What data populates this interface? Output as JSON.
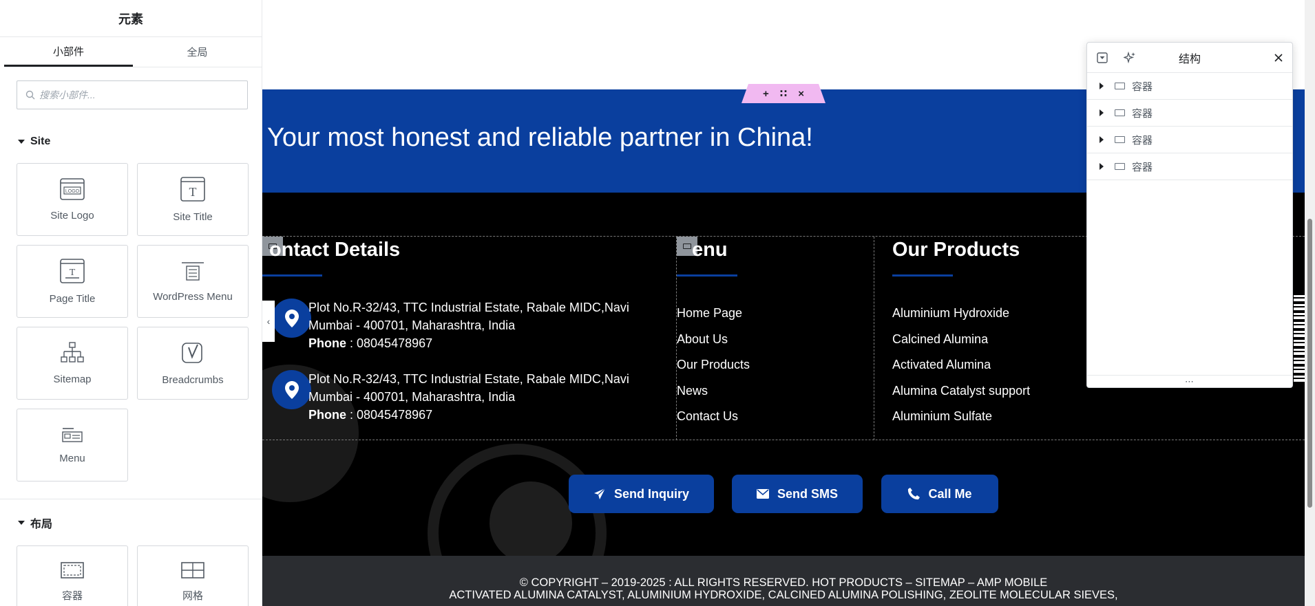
{
  "left_panel": {
    "title": "元素",
    "tabs": [
      "小部件",
      "全局"
    ],
    "search_placeholder": "搜索小部件...",
    "site_section": {
      "title": "Site",
      "widgets": [
        "Site Logo",
        "Site Title",
        "Page Title",
        "WordPress Menu",
        "Sitemap",
        "Breadcrumbs",
        "Menu"
      ]
    },
    "layout_section": {
      "title": "布局",
      "widgets": [
        "容器",
        "网格"
      ]
    }
  },
  "canvas": {
    "hero_text": "Your most honest and reliable partner in China!",
    "section_handle": {
      "add": "+",
      "move": "∷",
      "close": "×"
    },
    "footer": {
      "contact": {
        "heading": "ontact Details",
        "addresses": [
          {
            "line": "Plot No.R-32/43, TTC Industrial Estate, Rabale MIDC,Navi Mumbai - 400701, Maharashtra, India",
            "phone_label": "Phone",
            "phone": " : 08045478967"
          },
          {
            "line": "Plot No.R-32/43, TTC Industrial Estate, Rabale MIDC,Navi Mumbai - 400701, Maharashtra, India",
            "phone_label": "Phone",
            "phone": " : 08045478967"
          }
        ]
      },
      "menu": {
        "heading": "enu",
        "links": [
          "Home Page",
          "About Us",
          "Our Products",
          "News",
          "Contact Us"
        ]
      },
      "products": {
        "heading": "Our Products",
        "links": [
          "Aluminium Hydroxide",
          "Calcined Alumina",
          "Activated Alumina",
          "Alumina Catalyst support",
          "Aluminium Sulfate"
        ]
      },
      "cta_buttons": [
        "Send Inquiry",
        "Send SMS",
        "Call Me"
      ]
    },
    "copyright": {
      "line1": "© COPYRIGHT – 2019-2025 : ALL RIGHTS RESERVED. HOT PRODUCTS – SITEMAP – AMP MOBILE",
      "line2": "ACTIVATED ALUMINA CATALYST, ALUMINIUM HYDROXIDE, CALCINED ALUMINA POLISHING, ZEOLITE MOLECULAR SIEVES,"
    }
  },
  "structure_panel": {
    "title": "结构",
    "items": [
      "容器",
      "容器",
      "容器",
      "容器"
    ],
    "footer_dots": "⋯"
  },
  "colors": {
    "brand_blue": "#0a3f9e",
    "footer_bg": "#000000",
    "copyright_bg": "#2b2d31",
    "handle_pink": "#f1b9f1"
  }
}
